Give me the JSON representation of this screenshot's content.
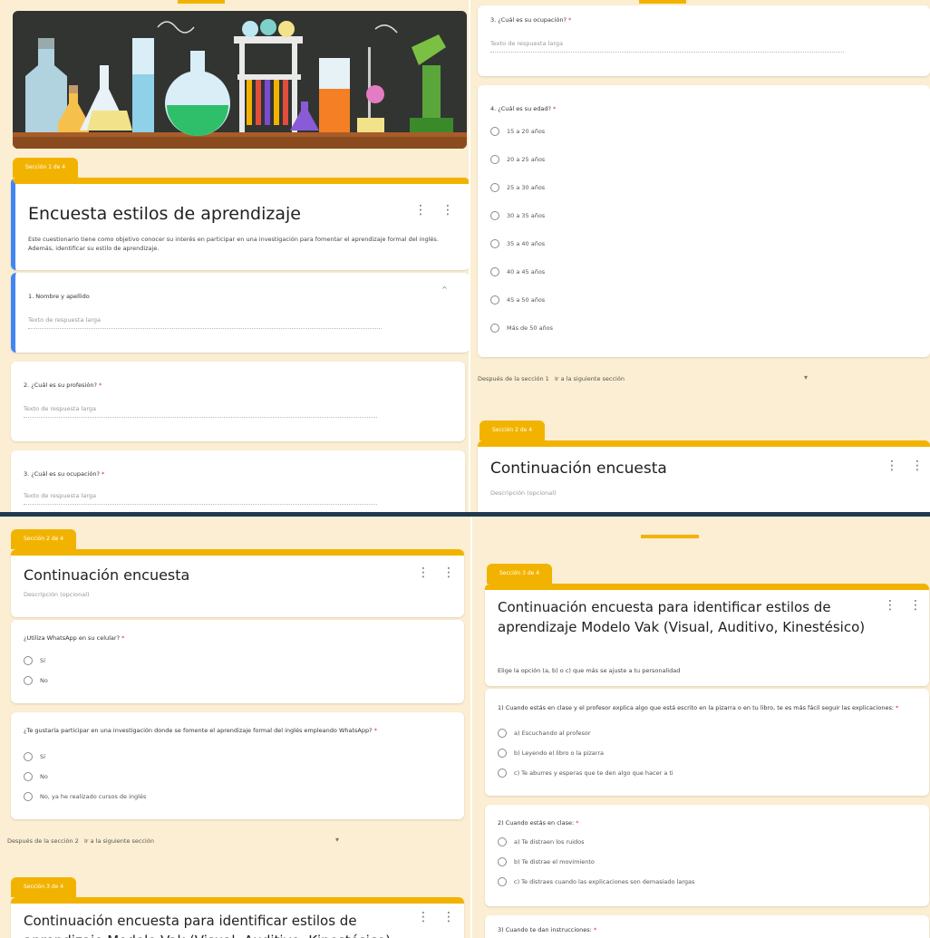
{
  "colors": {
    "accent": "#f2b300",
    "background": "#fbeed2",
    "active": "#4285f4",
    "banner_board": "#2d302e",
    "banner_table": "#8a4b1f"
  },
  "p1": {
    "section_tab": "Sección 1 de 4",
    "form_title": "Encuesta estilos de aprendizaje",
    "form_desc": "Este cuestionario tiene como objetivo conocer su interés en participar en una investigación para fomentar el aprendizaje formal del inglés. Además, identificar su estilo de aprendizaje.",
    "q1": "1. Nombre y apellido",
    "q1_placeholder": "Texto de respuesta larga",
    "q2": "2. ¿Cuál es su profesión?",
    "q2_placeholder": "Texto de respuesta larga",
    "q3": "3. ¿Cuál es su ocupación?",
    "q3_placeholder": "Texto de respuesta larga",
    "required": "*"
  },
  "p2": {
    "q3": "3. ¿Cuál es su ocupación?",
    "q3_placeholder": "Texto de respuesta larga",
    "q4": "4. ¿Cuál es su edad?",
    "ages": [
      "15 a 20 años",
      "20 a 25 años",
      "25 a 30 años",
      "30 a 35 años",
      "35 a 40 años",
      "40 a 45 años",
      "45 a 50 años",
      "Más de 50 años"
    ],
    "after_label": "Después de la sección 1",
    "after_value": "Ir a la siguiente sección",
    "section_tab": "Sección 2 de 4",
    "card_title": "Continuación encuesta",
    "card_desc": "Descripción (opcional)"
  },
  "p3": {
    "section_tab": "Sección 2 de 4",
    "card_title": "Continuación encuesta",
    "card_desc": "Descripción (opcional)",
    "q5": "¿Utiliza WhatsApp en su celular?",
    "q5_opts": [
      "Sí",
      "No"
    ],
    "q6": "¿Te gustaría participar en una investigación donde se fomente el aprendizaje formal del inglés empleando WhatsApp?",
    "q6_opts": [
      "Sí",
      "No",
      "No, ya he realizado cursos de inglés"
    ],
    "after_label": "Después de la sección 2",
    "after_value": "Ir a la siguiente sección",
    "section_tab2": "Sección 3 de 4",
    "card2_title": "Continuación encuesta para identificar estilos de aprendizaje Modelo Vak (Visual, Auditivo, Kinestésico)"
  },
  "p4": {
    "section_tab": "Sección 3 de 4",
    "card_title": "Continuación encuesta para identificar estilos de aprendizaje Modelo Vak (Visual, Auditivo, Kinestésico)",
    "card_desc": "Elige la opción (a, b) o c) que más se ajuste a tu personalidad",
    "q1": "1) Cuando estás en clase y el profesor explica algo que está escrito en la pizarra o en tu libro, te es más fácil seguir las explicaciones:",
    "q1_opts": [
      "a) Escuchando al profesor",
      "b) Leyendo el libro o la pizarra",
      "c) Te aburres y esperas que te den algo que hacer a ti"
    ],
    "q2": "2) Cuando estás en clase:",
    "q2_opts": [
      "a) Te distraen los ruidos",
      "b) Te distrae el movimiento",
      "c) Te distraes cuando las explicaciones son demasiado largas"
    ],
    "q3": "3) Cuando te dan instrucciones:"
  }
}
